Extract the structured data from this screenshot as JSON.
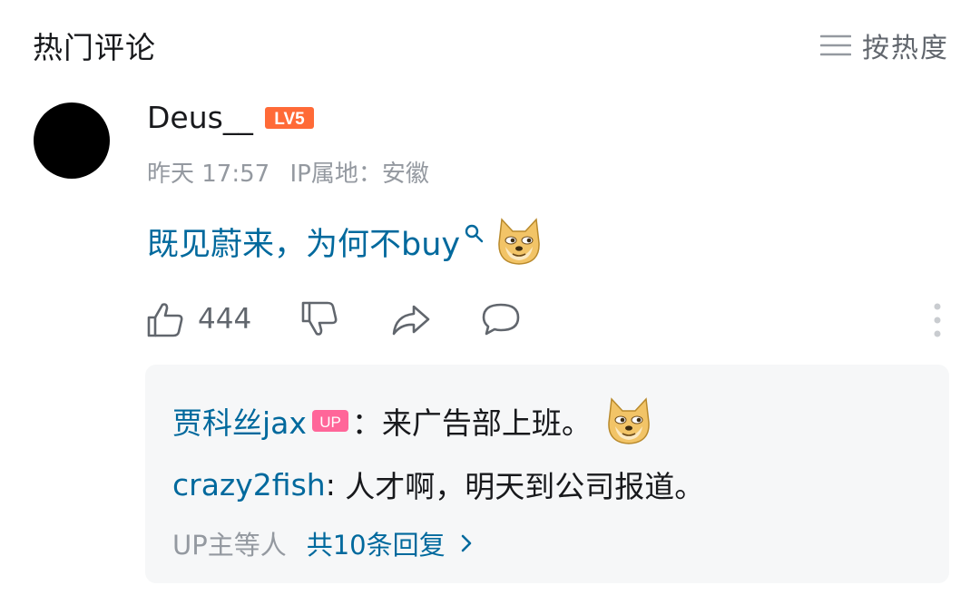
{
  "header": {
    "title": "热门评论",
    "sort_label": "按热度",
    "sort_icon": "list-lines-icon"
  },
  "comment": {
    "username": "Deus__",
    "level_badge": "LV5",
    "time": "昨天 17:57",
    "ip_location": "IP属地：安徽",
    "text": "既见蔚来，为何不buy",
    "emoji": "doge-emoji",
    "like_count": "444",
    "accent_color": "#00699d"
  },
  "replies": [
    {
      "username": "贾科丝jax",
      "badge": "UP",
      "sep": "：",
      "text": "来广告部上班。",
      "emoji": "doge-emoji"
    },
    {
      "username": "crazy2fish",
      "sep": ": ",
      "text": "人才啊，明天到公司报道。"
    }
  ],
  "reply_footer": {
    "who": "UP主等人",
    "more_label": "共10条回复"
  }
}
